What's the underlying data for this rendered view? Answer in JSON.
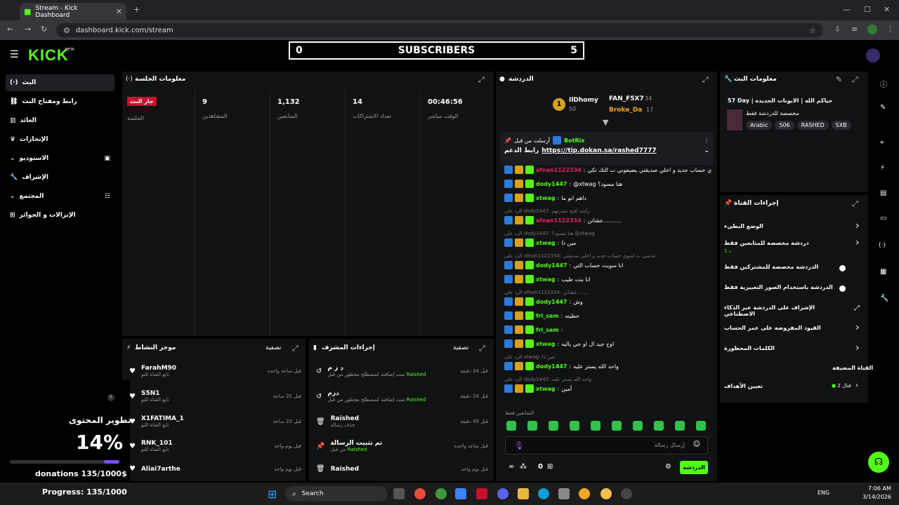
{
  "browser": {
    "tab_title": "Stream - Kick Dashboard",
    "url": "dashboard.kick.com/stream"
  },
  "header": {
    "logo": "KICK",
    "beta": "BETA"
  },
  "subs_widget": {
    "left": "0",
    "label": "SUBSCRIBERS",
    "right": "5"
  },
  "sidebar": {
    "items": [
      "البث",
      "رابط ومفتاح البث",
      "العائد",
      "الإنجازات",
      "الاستوديو",
      "الإشراف",
      "المجتمع",
      "الإنزالات و الجوائز"
    ]
  },
  "session": {
    "title": "معلومات الجلسة",
    "live_badge": "جار البث",
    "session_label": "الجلسة",
    "stats": [
      {
        "value": "9",
        "label": "المشاهدين"
      },
      {
        "value": "1,132",
        "label": "المتابعين"
      },
      {
        "value": "14",
        "label": "تعداد الاشتراكات"
      },
      {
        "value": "00:46:56",
        "label": "الوقت مباشر"
      }
    ]
  },
  "activity": {
    "title": "موجز النشاط",
    "filter": "تصفية",
    "items": [
      {
        "name": "FarahM90",
        "sub": "تابع القناة للتو",
        "time": "قبل ساعة واحدة"
      },
      {
        "name": "S5N1",
        "sub": "تابع القناة للتو",
        "time": "قبل 21 ساعة"
      },
      {
        "name": "X1FATIMA_1",
        "sub": "تابع القناة للتو",
        "time": "قبل 23 ساعة"
      },
      {
        "name": "RNK_101",
        "sub": "تابع القناة للتو",
        "time": "قبل يوم واحد"
      },
      {
        "name": "Aliai7arthe",
        "sub": "",
        "time": "قبل يوم واحد"
      }
    ]
  },
  "modactions": {
    "title": "إجراءات المشرف",
    "filter": "تصفية",
    "items": [
      {
        "name": "د ز م",
        "sub": "تمت إضافته كمصطلح محظور من قبل",
        "by": "Raished",
        "time": "قبل 24 دقيقة"
      },
      {
        "name": "دزم",
        "sub": "تمت إضافته كمصطلح محظور من قبل",
        "by": "Raished",
        "time": "قبل 24 دقيقة"
      },
      {
        "name": "Raished",
        "sub": "حذف رسالة",
        "by": "",
        "time": "قبل 45 دقيقة"
      },
      {
        "name": "تم تثبيت الرسالة",
        "sub": "من قبل",
        "by": "Raished",
        "time": "قبل ساعة واحدة"
      },
      {
        "name": "Raished",
        "sub": "",
        "by": "",
        "time": "قبل يوم واحد"
      }
    ]
  },
  "content_widget": {
    "title": "تطوير المحتوى",
    "percent": "14%",
    "progress": 0.14,
    "donations": "donations 135/1000$",
    "progress_text": "Progress: 135/1000"
  },
  "chat": {
    "title": "الدردشة",
    "top1": {
      "name": "IlDhomy",
      "count": "50",
      "rank": "1"
    },
    "top2": {
      "name": "FAN_F5X7",
      "count": "34"
    },
    "top3": {
      "name": "Broke_Da",
      "count": "17"
    },
    "pinned": {
      "by": "أرسلت من قبل",
      "user": "BotRix",
      "label": "رابط الدعم",
      "link": "https://tip.dokan.sa/rashed7777"
    },
    "lines": [
      {
        "type": "msg",
        "user": "afnan1122334",
        "ucolor": "#e0245e",
        "text": "عديتني ب اسوي حساب جديد و اخلي صديقتي يضيفوني ب التك تكي"
      },
      {
        "type": "msg",
        "user": "dody1447",
        "ucolor": "#53fc18",
        "text": "@xtwag هنا مسود؟"
      },
      {
        "type": "msg",
        "user": "xtwag",
        "ucolor": "#53fc18",
        "text": "داهم انو ما"
      },
      {
        "type": "reply",
        "text": "الرد على dody1447: راشد افتح صدرتهم"
      },
      {
        "type": "msg",
        "user": "afnan1122334",
        "ucolor": "#e0245e",
        "text": "عشانن.........."
      },
      {
        "type": "reply",
        "text": "الرد على dody1447: هنا مسود؟ @xtwag"
      },
      {
        "type": "msg",
        "user": "xtwag",
        "ucolor": "#53fc18",
        "text": "مين ذا"
      },
      {
        "type": "reply",
        "text": "الرد على afnan1122334: عديتني ب اسوي حساب جديد و اخلي صديقتي"
      },
      {
        "type": "msg",
        "user": "dody1447",
        "ucolor": "#53fc18",
        "text": "انا سويت حساب الثي"
      },
      {
        "type": "msg",
        "user": "xtwag",
        "ucolor": "#53fc18",
        "text": "انا بنت طيب"
      },
      {
        "type": "reply",
        "text": "الرد على afnan1122334: عشانن........"
      },
      {
        "type": "msg",
        "user": "dody1447",
        "ucolor": "#53fc18",
        "text": "وش"
      },
      {
        "type": "msg",
        "user": "frl_sam",
        "ucolor": "#53fc18",
        "text": "حطيته"
      },
      {
        "type": "msg",
        "user": "frl_sam",
        "ucolor": "#53fc18",
        "text": ""
      },
      {
        "type": "msg",
        "user": "xtwag",
        "ucolor": "#53fc18",
        "text": "اوح جيد ال او جي ياليه"
      },
      {
        "type": "reply",
        "text": "الرد على xtwag: مين ذا"
      },
      {
        "type": "msg",
        "user": "dody1447",
        "ucolor": "#53fc18",
        "text": "واحد الله يستر عليه"
      },
      {
        "type": "reply",
        "text": "الرد على dody1447: واحد الله يستر عليه"
      },
      {
        "type": "msg",
        "user": "xtwag",
        "ucolor": "#53fc18",
        "text": "أمين"
      }
    ],
    "followers_only": "المتابعين فقط",
    "input_placeholder": "إرسال رسالة",
    "send": "الدردشة",
    "count": "0"
  },
  "streaminfo": {
    "title": "معلومات البث",
    "stream_title": "57 Day | حياكم الله | الايونات الجديده",
    "category": "مخصصة للدردشة فقط",
    "tags": [
      "Arabic",
      "506",
      "RASHED",
      "SXB"
    ]
  },
  "channel_actions": {
    "title": "إجراءات القناة",
    "items": [
      {
        "label": "الوضع البطيء",
        "ctrl": "chev"
      },
      {
        "label": "دردشة مخصصة للمتابعين فقط",
        "sub": "1 د",
        "ctrl": "chev"
      },
      {
        "label": "الدردشة مخصصة للمشتركين فقط",
        "ctrl": "toggle"
      },
      {
        "label": "الدردشة باستخدام الصور التعبيرية فقط",
        "ctrl": "toggle"
      },
      {
        "label": "الإشراف على الدردشة عبر الذكاء الاصطناعي",
        "ctrl": "ext"
      },
      {
        "label": "القيود المفروضة على عمر الحساب",
        "ctrl": "chev"
      },
      {
        "label": "الكلمات المحظورة",
        "ctrl": "chev"
      }
    ],
    "tabs_label": "القناة المضيفة",
    "goals_label": "تعيين الأهداف",
    "goals_value": "قنال 2"
  },
  "taskbar": {
    "search": "Search",
    "lang": "ENG",
    "time": "7:06 AM",
    "date": "3/14/2026"
  }
}
